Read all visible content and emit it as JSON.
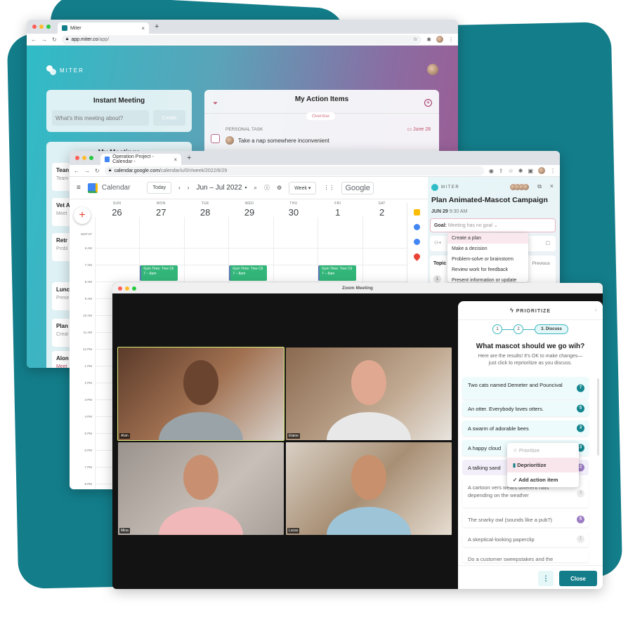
{
  "colors": {
    "brand_teal": "#137d8a",
    "accent_pink": "#c0506a",
    "event_green": "#33b679"
  },
  "miter_app": {
    "tab_title": "Miter",
    "url_host": "app.miter.co",
    "url_path": "/app/",
    "logo_text": "MITER",
    "instant_meeting": {
      "title": "Instant Meeting",
      "placeholder": "What's this meeting about?",
      "create_label": "Create"
    },
    "my_meetings": {
      "title": "My Meetings",
      "items": [
        {
          "title": "Tean",
          "sub": "Team"
        },
        {
          "title": "Vet A",
          "sub": "Meet"
        },
        {
          "title": "Retr",
          "sub": "Probl"
        },
        {
          "title": "Lunc",
          "sub": "Prese"
        },
        {
          "title": "Plan",
          "sub": "Creat"
        },
        {
          "title": "Alon",
          "sub": "Meet"
        }
      ]
    },
    "action_items": {
      "title": "My Action Items",
      "overdue_label": "Overdue",
      "task_type": "PERSONAL TASK",
      "task_due": "June 28",
      "task_text": "Take a nap somewhere inconvenient"
    }
  },
  "calendar": {
    "tab_title": "Operation Project - Calendar -",
    "url_host": "calendar.google.com",
    "url_path": "/calendar/u/0/r/week/2022/6/29",
    "app_name": "Calendar",
    "today_label": "Today",
    "range_label": "Jun – Jul 2022",
    "view_label": "Week",
    "google_label": "Google",
    "tz_label": "GMT-07",
    "days": [
      {
        "name": "SUN",
        "num": "26"
      },
      {
        "name": "MON",
        "num": "27"
      },
      {
        "name": "TUE",
        "num": "28"
      },
      {
        "name": "WED",
        "num": "29"
      },
      {
        "name": "THU",
        "num": "30"
      },
      {
        "name": "FRI",
        "num": "1"
      },
      {
        "name": "SAT",
        "num": "2"
      }
    ],
    "hours": [
      "6 AM",
      "7 AM",
      "8 AM",
      "9 AM",
      "10 AM",
      "11 AM",
      "12 PM",
      "1 PM",
      "2 PM",
      "3 PM",
      "4 PM",
      "5 PM",
      "6 PM",
      "7 PM",
      "8 PM"
    ],
    "events": [
      {
        "title": "Gym Time: Tree Cli",
        "time": "7 – 8am",
        "day": "MON"
      },
      {
        "title": "Gym Time: Tree Cli",
        "time": "7 – 8am",
        "day": "WED"
      },
      {
        "title": "Gym Time: Tree Cli",
        "time": "7 – 8am",
        "day": "FRI"
      }
    ]
  },
  "miter_sidebar": {
    "logo_text": "MITER",
    "meeting_title": "Plan Animated-Mascot Campaign",
    "date": "JUN 29",
    "time": "9:30 AM",
    "goal_label": "Goal:",
    "goal_value": "Meeting has no goal",
    "goal_options": [
      "Create a plan",
      "Make a decision",
      "Problem-solve or brainstorm",
      "Review work for feedback",
      "Present information or update"
    ],
    "topics_label": "Topic",
    "previous_label": "Previous",
    "topic_num": "1"
  },
  "zoom": {
    "window_title": "Zoom Meeting",
    "participants": [
      {
        "name": "Alvin",
        "active": true
      },
      {
        "name": "Elaine"
      },
      {
        "name": "Mina"
      },
      {
        "name": "Lucas"
      }
    ]
  },
  "prioritize": {
    "header": "PRIORITIZE",
    "steps": [
      "1",
      "2",
      "3. Discuss"
    ],
    "question": "What mascot should we go wih?",
    "subtitle_1": "Here are the results! It’s OK to make changes—",
    "subtitle_2": "just click to reprioritize as you discuss.",
    "options": [
      {
        "text": "Two cats named Demeter and Pouncival",
        "votes": "7",
        "status": "prioritized"
      },
      {
        "text": "An otter. Everybody loves otters.",
        "votes": "5",
        "status": "prioritized"
      },
      {
        "text": "A swarm of adorable bees",
        "votes": "3",
        "status": "prioritized"
      },
      {
        "text": "A happy cloud",
        "votes": "3",
        "status": "prioritized"
      },
      {
        "text": "A talking sand",
        "votes": "2",
        "status": "deprioritized"
      },
      {
        "text": "A cartoon vers wears different hats depending on the weather",
        "votes": "3",
        "status": "neutral"
      },
      {
        "text": "The snarky owl (sounds like a pub?)",
        "votes": "5",
        "status": "deprioritized"
      },
      {
        "text": "A skeptical-looking paperclip",
        "votes": "1",
        "status": "neutral"
      },
      {
        "text": "Do a customer sweepstakes and the",
        "votes": "",
        "status": "neutral"
      }
    ],
    "context_menu": [
      "Prioritize",
      "Deprioritize",
      "Add action item"
    ],
    "close_label": "Close",
    "more_label": "⋮"
  }
}
